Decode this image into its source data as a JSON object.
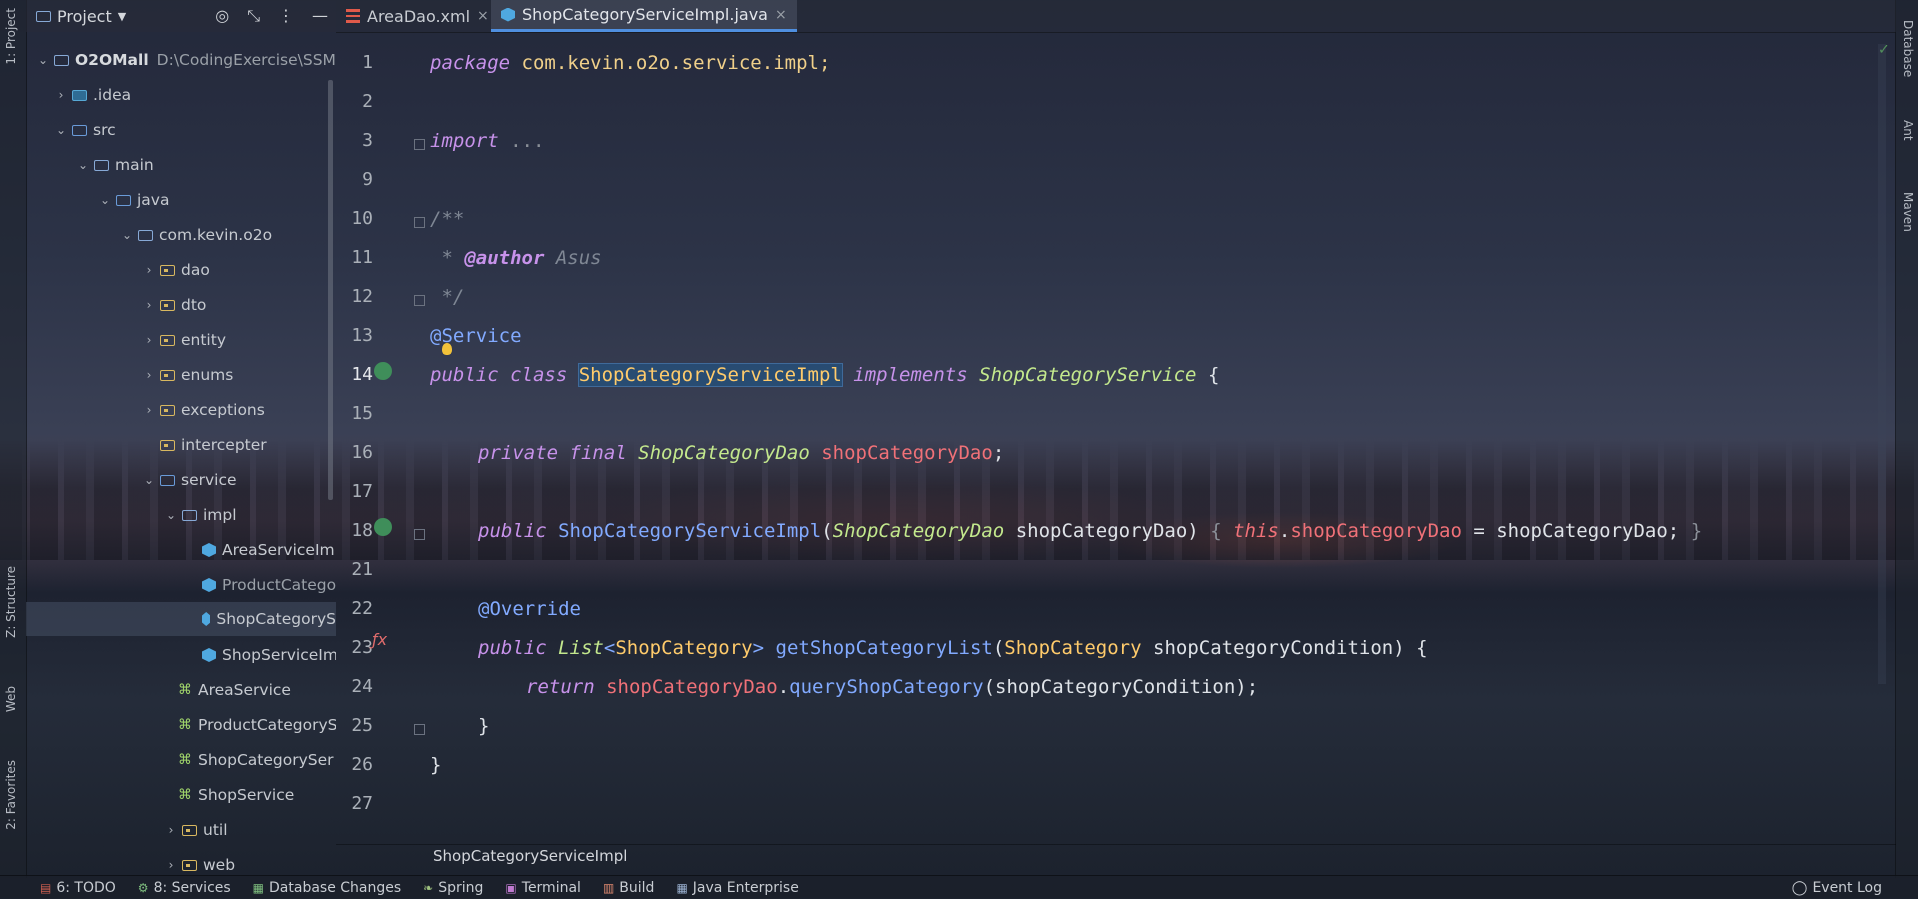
{
  "toolwindow": {
    "project_label": "Project",
    "vertical_left": [
      "1: Project",
      "Z: Structure",
      "Web",
      "2: Favorites"
    ],
    "vertical_right": [
      "Database",
      "Ant",
      "Maven"
    ]
  },
  "tree": {
    "project_name": "O2OMall",
    "project_path": "D:\\CodingExercise\\SSM-S",
    "items": [
      {
        "label": ".idea"
      },
      {
        "label": "src"
      },
      {
        "label": "main"
      },
      {
        "label": "java"
      },
      {
        "label": "com.kevin.o2o"
      },
      {
        "label": "dao"
      },
      {
        "label": "dto"
      },
      {
        "label": "entity"
      },
      {
        "label": "enums"
      },
      {
        "label": "exceptions"
      },
      {
        "label": "intercepter"
      },
      {
        "label": "service"
      },
      {
        "label": "impl"
      },
      {
        "label": "AreaServiceImp"
      },
      {
        "label": "ProductCatego"
      },
      {
        "label": "ShopCategoryS"
      },
      {
        "label": "ShopServiceIm"
      },
      {
        "label": "AreaService"
      },
      {
        "label": "ProductCategoryS"
      },
      {
        "label": "ShopCategorySer"
      },
      {
        "label": "ShopService"
      },
      {
        "label": "util"
      },
      {
        "label": "web"
      }
    ]
  },
  "tabs": [
    {
      "label": "AreaDao.xml",
      "close": "×"
    },
    {
      "label": "ShopCategoryServiceImpl.java",
      "close": "×"
    }
  ],
  "editor": {
    "line_numbers": [
      "1",
      "2",
      "3",
      "9",
      "10",
      "11",
      "12",
      "13",
      "14",
      "15",
      "16",
      "17",
      "18",
      "21",
      "22",
      "23",
      "24",
      "25",
      "26",
      "27"
    ],
    "code": {
      "l1_kw": "package",
      "l1_pkg": "com.kevin.o2o.service.impl;",
      "l3_kw": "import",
      "l3_dots": "...",
      "l10": "/**",
      "l11_star": " * ",
      "l11_tag": "@author",
      "l11_name": "Asus",
      "l12": " */",
      "l13": "@Service",
      "l14_kw": "public class",
      "l14_cls": "ShopCategoryServiceImpl",
      "l14_impl": "implements",
      "l14_iface": "ShopCategoryService",
      "l14_brace": "{",
      "l16_kw": "private final",
      "l16_type": "ShopCategoryDao",
      "l16_field": "shopCategoryDao",
      "l16_semi": ";",
      "l18_kw": "public",
      "l18_fn": "ShopCategoryServiceImpl",
      "l18_p1": "(",
      "l18_type": "ShopCategoryDao",
      "l18_param": "shopCategoryDao)",
      "l18_ob": "{",
      "l18_this": "this",
      "l18_dot": ".",
      "l18_field": "shopCategoryDao",
      "l18_eq": " = shopCategoryDao;",
      "l18_cb": "}",
      "l22": "@Override",
      "l23_kw": "public",
      "l23_list": "List",
      "l23_lt": "<",
      "l23_gen": "ShopCategory",
      "l23_gt": ">",
      "l23_fn": "getShopCategoryList",
      "l23_p": "(",
      "l23_ptype": "ShopCategory",
      "l23_rest": "shopCategoryCondition) {",
      "l24_kw": "return",
      "l24_field": "shopCategoryDao",
      "l24_dot": ".",
      "l24_fn": "queryShopCategory",
      "l24_rest": "(shopCategoryCondition);",
      "l25": "}",
      "l26": "}"
    }
  },
  "breadcrumb": "ShopCategoryServiceImpl",
  "statusbar": {
    "todo": "6: TODO",
    "services": "8: Services",
    "dbchanges": "Database Changes",
    "spring": "Spring",
    "terminal": "Terminal",
    "build": "Build",
    "javaee": "Java Enterprise",
    "eventlog": "Event Log"
  },
  "colors": {
    "accent": "#4f8fe0",
    "selection": "#264f78"
  }
}
